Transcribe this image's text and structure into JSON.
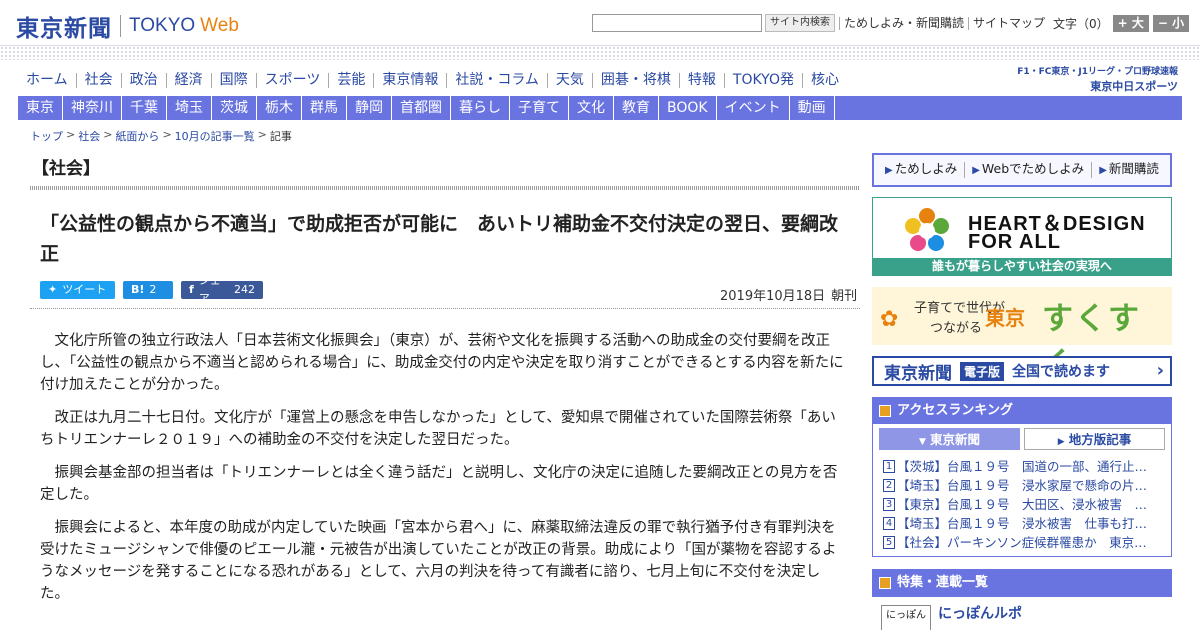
{
  "header": {
    "logo_jp": "東京新聞",
    "logo_tokyo": "TOKYO",
    "logo_web": "Web",
    "search_placeholder": "",
    "search_button": "サイト内検索",
    "links": [
      "ためしよみ・新聞購読",
      "サイトマップ"
    ],
    "text_size_label": "文字（0）",
    "size_up": "+ 大",
    "size_down": "− 小"
  },
  "main_nav": [
    "ホーム",
    "社会",
    "政治",
    "経済",
    "国際",
    "スポーツ",
    "芸能",
    "東京情報",
    "社説・コラム",
    "天気",
    "囲碁・将棋",
    "特報",
    "TOKYO発",
    "核心"
  ],
  "chunichi": {
    "line1": "F1・FC東京・J1リーグ・プロ野球速報",
    "line2": "東京中日スポーツ"
  },
  "sub_nav": [
    "東京",
    "神奈川",
    "千葉",
    "埼玉",
    "茨城",
    "栃木",
    "群馬",
    "静岡",
    "首都圏",
    "暮らし",
    "子育て",
    "文化",
    "教育",
    "BOOK",
    "イベント",
    "動画"
  ],
  "breadcrumb": [
    "トップ",
    "社会",
    "紙面から",
    "10月の記事一覧",
    "記事"
  ],
  "article": {
    "section": "【社会】",
    "headline": "「公益性の観点から不適当」で助成拒否が可能に　あいトリ補助金不交付決定の翌日、要綱改正",
    "share": {
      "tweet": "ツイート",
      "hatena_count": "2",
      "facebook": "シェア",
      "facebook_count": "242"
    },
    "date": "2019年10月18日",
    "edition": "朝刊",
    "paragraphs": [
      "文化庁所管の独立行政法人「日本芸術文化振興会」（東京）が、芸術や文化を振興する活動への助成金の交付要綱を改正し、「公益性の観点から不適当と認められる場合」に、助成金交付の内定や決定を取り消すことができるとする内容を新たに付け加えたことが分かった。",
      "改正は九月二十七日付。文化庁が「運営上の懸念を申告しなかった」として、愛知県で開催されていた国際芸術祭「あいちトリエンナーレ２０１９」への補助金の不交付を決定した翌日だった。",
      "振興会基金部の担当者は「トリエンナーレとは全く違う話だ」と説明し、文化庁の決定に追随した要綱改正との見方を否定した。",
      "振興会によると、本年度の助成が内定していた映画「宮本から君へ」に、麻薬取締法違反の罪で執行猶予付き有罪判決を受けたミュージシャンで俳優のピエール瀧・元被告が出演していたことが改正の背景。助成により「国が薬物を容認するようなメッセージを発することになる恐れがある」として、六月の判決を待って有識者に諮り、七月上旬に不交付を決定した。"
    ]
  },
  "sidebar": {
    "promo_tabs": [
      "ためしよみ",
      "Webでためしよみ",
      "新聞購読"
    ],
    "hd_line1": "HEART＆DESIGN",
    "hd_line2": "FOR ALL",
    "hd_strip": "誰もが暮らしやすい社会の実現へ",
    "suku_sub1": "子育てで世代が",
    "suku_sub2": "つながる",
    "suku_tokyo": "東京",
    "suku_main": "すくすく",
    "denshi_logo": "東京新聞",
    "denshi_badge": "電子版",
    "denshi_text": "全国で読めます",
    "ranking_title": "アクセスランキング",
    "ranking_tabs": [
      "東京新聞",
      "地方版記事"
    ],
    "ranking": [
      {
        "num": "1",
        "text": "【茨城】台風１９号　国道の一部、通行止…"
      },
      {
        "num": "2",
        "text": "【埼玉】台風１９号　浸水家屋で懸命の片…"
      },
      {
        "num": "3",
        "text": "【東京】台風１９号　大田区、浸水被害　…"
      },
      {
        "num": "4",
        "text": "【埼玉】台風１９号　浸水被害　仕事も打…"
      },
      {
        "num": "5",
        "text": "【社会】パーキンソン症候群罹患か　東京…"
      }
    ],
    "feature_title": "特集・連載一覧",
    "feature_item": "にっぽんルポ",
    "feature_thumb": "にっぽん"
  },
  "colors": {
    "brand_blue": "#2b4aa3",
    "nav_purple": "#6a74e0",
    "accent_orange": "#e8820e",
    "hd_green": "#39a08a"
  }
}
